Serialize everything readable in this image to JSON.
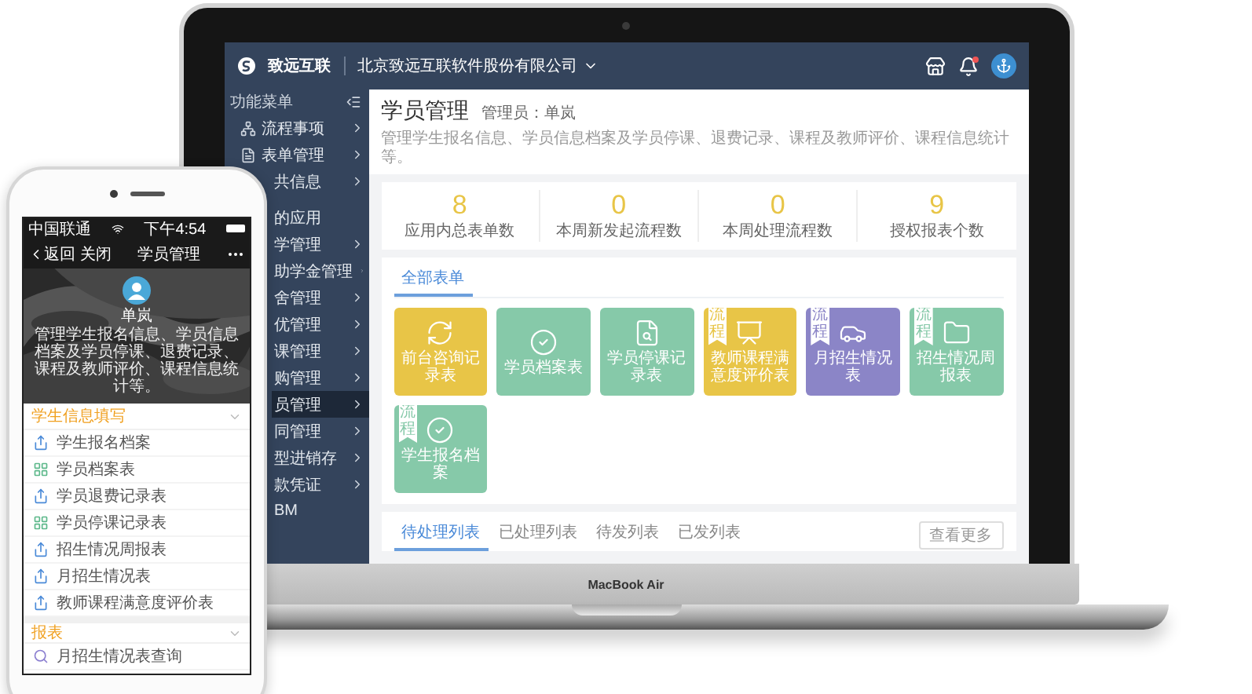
{
  "laptop": {
    "brand": "MacBook Air",
    "header": {
      "logo": "致远互联",
      "company": "北京致远互联软件股份有限公司"
    },
    "sidebar": {
      "title": "功能菜单",
      "items": [
        {
          "label": "流程事项",
          "kind": "item",
          "selected": false
        },
        {
          "label": "表单管理",
          "kind": "item",
          "selected": false
        },
        {
          "label": "共信息",
          "kind": "item",
          "selected": false
        },
        {
          "label": "的应用",
          "kind": "heading",
          "selected": false
        },
        {
          "label": "学管理",
          "kind": "item",
          "selected": false
        },
        {
          "label": "助学金管理",
          "kind": "item",
          "selected": false
        },
        {
          "label": "舍管理",
          "kind": "item",
          "selected": false
        },
        {
          "label": "优管理",
          "kind": "item",
          "selected": false
        },
        {
          "label": "课管理",
          "kind": "item",
          "selected": false
        },
        {
          "label": "购管理",
          "kind": "item",
          "selected": false
        },
        {
          "label": "员管理",
          "kind": "item",
          "selected": true
        },
        {
          "label": "同管理",
          "kind": "item",
          "selected": false
        },
        {
          "label": "型进销存",
          "kind": "item",
          "selected": false
        },
        {
          "label": "款凭证",
          "kind": "item",
          "selected": false
        },
        {
          "label": "BM",
          "kind": "heading",
          "selected": false
        }
      ]
    },
    "page": {
      "title": "学员管理",
      "admin": "管理员：单岚",
      "description": "管理学生报名信息、学员信息档案及学员停课、退费记录、课程及教师评价、课程信息统计等。"
    },
    "stats": [
      {
        "value": "8",
        "label": "应用内总表单数"
      },
      {
        "value": "0",
        "label": "本周新发起流程数"
      },
      {
        "value": "0",
        "label": "本周处理流程数"
      },
      {
        "value": "9",
        "label": "授权报表个数"
      }
    ],
    "forms": {
      "tabs": [
        {
          "label": "全部表单",
          "selected": true
        }
      ],
      "tiles": [
        {
          "label": "前台咨询记录表",
          "color": "#e8c547"
        },
        {
          "label": "学员档案表",
          "color": "#86c9a9"
        },
        {
          "label": "学员停课记录表",
          "color": "#86c9a9"
        },
        {
          "label": "教师课程满意度评价表",
          "color": "#e8c547",
          "flag": "流程"
        },
        {
          "label": "月招生情况表",
          "color": "#8b85c7",
          "flag": "流程"
        },
        {
          "label": "招生情况周报表",
          "color": "#86c9a9",
          "flag": "流程"
        },
        {
          "label": "学生报名档案",
          "color": "#86c9a9",
          "flag": "流程"
        }
      ]
    },
    "lists": {
      "tabs": [
        {
          "label": "待处理列表",
          "selected": true
        },
        {
          "label": "已处理列表",
          "selected": false
        },
        {
          "label": "待发列表",
          "selected": false
        },
        {
          "label": "已发列表",
          "selected": false
        }
      ],
      "more_button": "查看更多"
    }
  },
  "phone": {
    "status": {
      "carrier": "中国联通",
      "time": "下午4:54"
    },
    "nav": {
      "back": "返回",
      "close": "关闭",
      "title": "学员管理"
    },
    "banner": {
      "name": "单岚",
      "description": "管理学生报名信息、学员信息档案及学员停课、退费记录、课程及教师评价、课程信息统计等。"
    },
    "sections": [
      {
        "title": "学生信息填写",
        "items": [
          {
            "label": "学生报名档案",
            "kind": "share"
          },
          {
            "label": "学员档案表",
            "kind": "grid"
          },
          {
            "label": "学员退费记录表",
            "kind": "share"
          },
          {
            "label": "学员停课记录表",
            "kind": "grid"
          },
          {
            "label": "招生情况周报表",
            "kind": "share"
          },
          {
            "label": "月招生情况表",
            "kind": "share"
          },
          {
            "label": "教师课程满意度评价表",
            "kind": "share"
          }
        ]
      },
      {
        "title": "报表",
        "items": [
          {
            "label": "月招生情况表查询",
            "kind": "search"
          }
        ]
      }
    ]
  }
}
